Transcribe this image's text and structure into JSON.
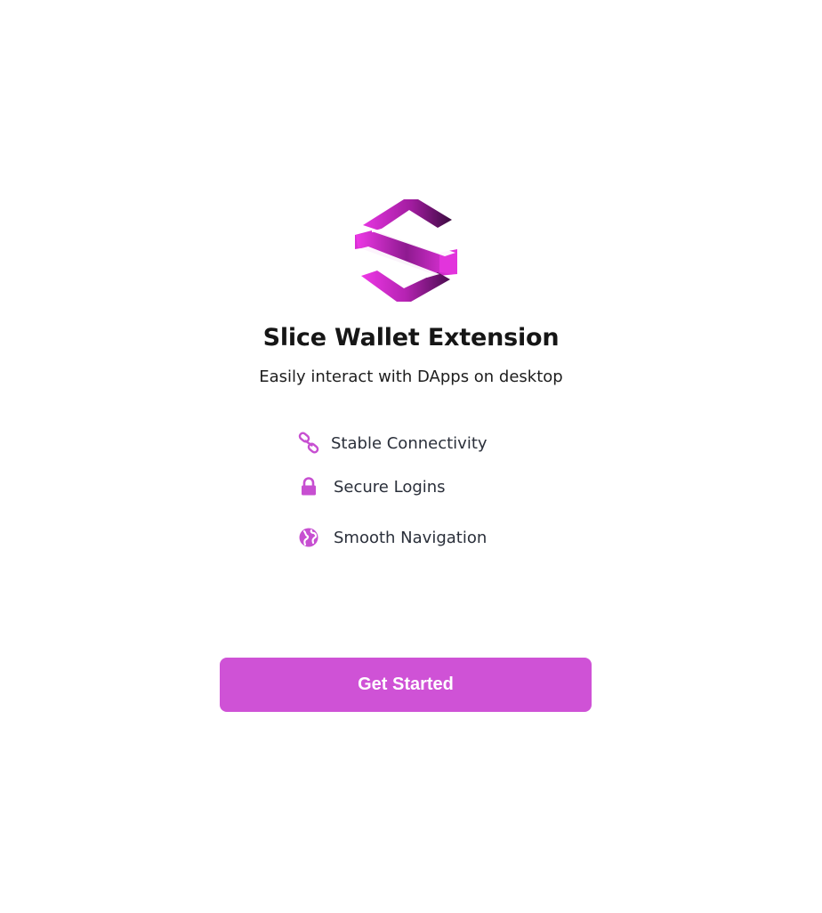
{
  "brand": {
    "logo_icon": "slice-s-logo-icon",
    "gradient_light": "#e535e0",
    "gradient_dark": "#3a0a3f"
  },
  "header": {
    "title": "Slice Wallet Extension",
    "subtitle": "Easily interact with DApps on desktop"
  },
  "features": [
    {
      "label": "Stable Connectivity",
      "icon": "link-icon"
    },
    {
      "label": "Secure Logins",
      "icon": "lock-icon"
    },
    {
      "label": "Smooth Navigation",
      "icon": "globe-icon"
    }
  ],
  "colors": {
    "accent": "#cf52d6",
    "feature_icon": "#c74fd1",
    "button_text": "#ffffff"
  },
  "cta": {
    "label": "Get Started"
  }
}
